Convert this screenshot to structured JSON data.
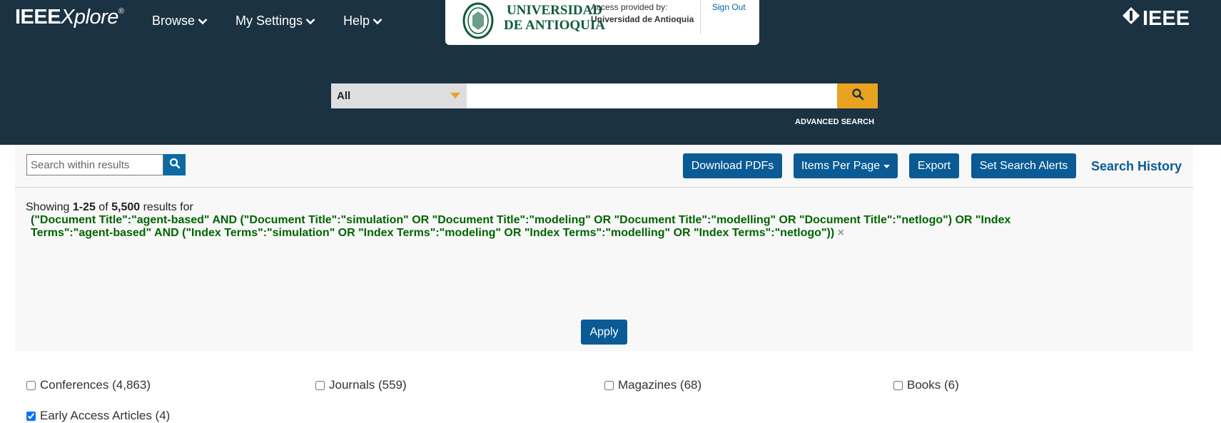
{
  "header": {
    "brand": {
      "part1": "IEEE",
      "part2": "Xplore",
      "mark": "®"
    },
    "nav": [
      {
        "label": "Browse"
      },
      {
        "label": "My Settings"
      },
      {
        "label": "Help"
      }
    ],
    "institution": {
      "name": "UNIVERSIDAD\nDE ANTIOQUIA",
      "access_label": "Access provided by:",
      "access_name": "Universidad de Antioquia",
      "sign_out": "Sign Out"
    },
    "ieee_logo": "IEEE"
  },
  "search": {
    "scope": "All",
    "query": "",
    "advanced": "ADVANCED SEARCH"
  },
  "toolbar": {
    "within_placeholder": "Search within results",
    "download": "Download PDFs",
    "items_per_page": "Items Per Page",
    "export": "Export",
    "alerts": "Set Search Alerts",
    "history": "Search History"
  },
  "results": {
    "showing_prefix": "Showing ",
    "range": "1-25",
    "of": " of ",
    "total": "5,500",
    "suffix": " results for",
    "query_line1": "(\"Document Title\":\"agent-based\" AND (\"Document Title\":\"simulation\" OR \"Document Title\":\"modeling\" OR \"Document Title\":\"modelling\" OR \"Document Title\":\"netlogo\") OR \"Index",
    "query_line2": "Terms\":\"agent-based\" AND (\"Index Terms\":\"simulation\" OR \"Index Terms\":\"modeling\" OR \"Index Terms\":\"modelling\" OR \"Index Terms\":\"netlogo\"))",
    "clear": "×"
  },
  "facets": [
    {
      "label": "Conferences (4,863)",
      "checked": false
    },
    {
      "label": "Journals (559)",
      "checked": false
    },
    {
      "label": "Magazines (68)",
      "checked": false
    },
    {
      "label": "Books (6)",
      "checked": false
    },
    {
      "label": "Early Access Articles (4)",
      "checked": true
    }
  ],
  "apply": "Apply",
  "colors": {
    "header_bg": "#1b3242",
    "accent": "#e9a320",
    "button": "#0a5b95",
    "query": "#006400"
  }
}
